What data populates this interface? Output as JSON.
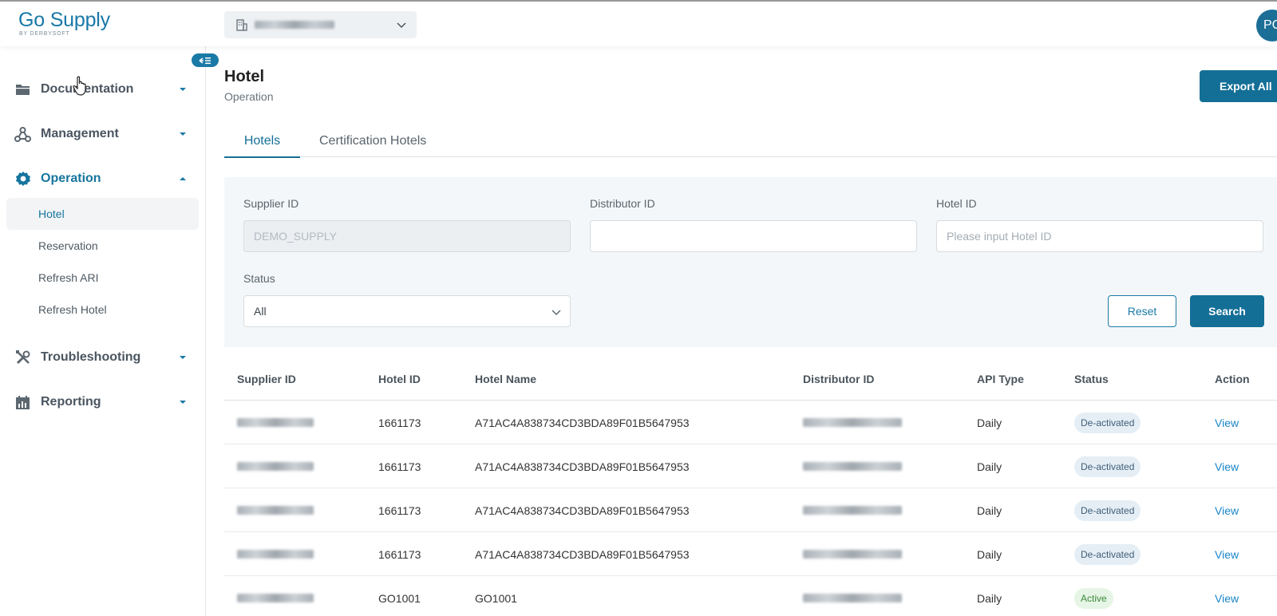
{
  "header": {
    "logo_main": "Go Supply",
    "logo_sub": "BY DERBYSOFT",
    "supplier_select_icon": "building-icon",
    "avatar_initials": "PC"
  },
  "sidebar": {
    "groups": [
      {
        "label": "Documentation",
        "icon": "folder-icon"
      },
      {
        "label": "Management",
        "icon": "network-icon"
      },
      {
        "label": "Operation",
        "icon": "gear-icon"
      },
      {
        "label": "Troubleshooting",
        "icon": "tools-icon"
      },
      {
        "label": "Reporting",
        "icon": "report-icon"
      }
    ],
    "operation_items": [
      {
        "label": "Hotel"
      },
      {
        "label": "Reservation"
      },
      {
        "label": "Refresh ARI"
      },
      {
        "label": "Refresh Hotel"
      }
    ]
  },
  "page": {
    "title": "Hotel",
    "subtitle": "Operation",
    "export_label": "Export All"
  },
  "tabs": [
    {
      "label": "Hotels"
    },
    {
      "label": "Certification Hotels"
    }
  ],
  "filter": {
    "supplier_id_label": "Supplier ID",
    "supplier_id_value": "DEMO_SUPPLY",
    "distributor_id_label": "Distributor ID",
    "distributor_id_value": "",
    "hotel_id_label": "Hotel ID",
    "hotel_id_placeholder": "Please input Hotel ID",
    "status_label": "Status",
    "status_value": "All",
    "reset_label": "Reset",
    "search_label": "Search"
  },
  "table": {
    "columns": [
      "Supplier ID",
      "Hotel ID",
      "Hotel Name",
      "Distributor ID",
      "API Type",
      "Status",
      "Action"
    ],
    "rows": [
      {
        "hotel_id": "1661173",
        "hotel_name": "A71AC4A838734CD3BDA89F01B5647953",
        "api_type": "Daily",
        "status": "De-activated",
        "action": "View"
      },
      {
        "hotel_id": "1661173",
        "hotel_name": "A71AC4A838734CD3BDA89F01B5647953",
        "api_type": "Daily",
        "status": "De-activated",
        "action": "View"
      },
      {
        "hotel_id": "1661173",
        "hotel_name": "A71AC4A838734CD3BDA89F01B5647953",
        "api_type": "Daily",
        "status": "De-activated",
        "action": "View"
      },
      {
        "hotel_id": "1661173",
        "hotel_name": "A71AC4A838734CD3BDA89F01B5647953",
        "api_type": "Daily",
        "status": "De-activated",
        "action": "View"
      },
      {
        "hotel_id": "GO1001",
        "hotel_name": "GO1001",
        "api_type": "Daily",
        "status": "Active",
        "action": "View"
      }
    ]
  },
  "colors": {
    "brand": "#146f97",
    "link": "#1a86c8",
    "active_badge_bg": "#e6f5e6",
    "inactive_badge_bg": "#e5eef5"
  }
}
